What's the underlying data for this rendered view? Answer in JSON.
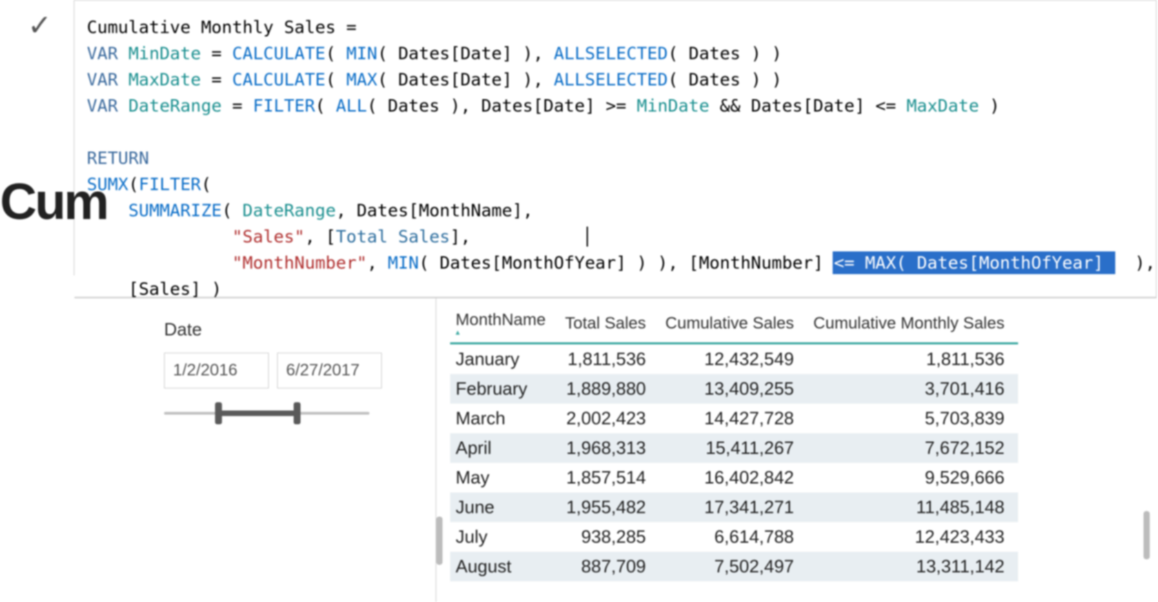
{
  "page_title_fragment": "Cum",
  "formula": {
    "lines": [
      [
        {
          "t": "Cumulative Monthly Sales = "
        }
      ],
      [
        {
          "t": "VAR ",
          "c": "var"
        },
        {
          "t": "MinDate",
          "c": "ref"
        },
        {
          "t": " = "
        },
        {
          "t": "CALCULATE",
          "c": "kw"
        },
        {
          "t": "( "
        },
        {
          "t": "MIN",
          "c": "kw"
        },
        {
          "t": "( Dates[Date] ), "
        },
        {
          "t": "ALLSELECTED",
          "c": "kw"
        },
        {
          "t": "( Dates ) )"
        }
      ],
      [
        {
          "t": "VAR ",
          "c": "var"
        },
        {
          "t": "MaxDate",
          "c": "ref"
        },
        {
          "t": " = "
        },
        {
          "t": "CALCULATE",
          "c": "kw"
        },
        {
          "t": "( "
        },
        {
          "t": "MAX",
          "c": "kw"
        },
        {
          "t": "( Dates[Date] ), "
        },
        {
          "t": "ALLSELECTED",
          "c": "kw"
        },
        {
          "t": "( Dates ) )"
        }
      ],
      [
        {
          "t": "VAR ",
          "c": "var"
        },
        {
          "t": "DateRange",
          "c": "ref"
        },
        {
          "t": " = "
        },
        {
          "t": "FILTER",
          "c": "kw"
        },
        {
          "t": "( "
        },
        {
          "t": "ALL",
          "c": "kw"
        },
        {
          "t": "( Dates ), Dates[Date] >= "
        },
        {
          "t": "MinDate",
          "c": "ref"
        },
        {
          "t": " && Dates[Date] <= "
        },
        {
          "t": "MaxDate",
          "c": "ref"
        },
        {
          "t": " )"
        }
      ],
      [
        {
          "t": " "
        }
      ],
      [
        {
          "t": "RETURN",
          "c": "retkw"
        }
      ],
      [
        {
          "t": "SUMX",
          "c": "kw"
        },
        {
          "t": "("
        },
        {
          "t": "FILTER",
          "c": "kw"
        },
        {
          "t": "("
        }
      ],
      [
        {
          "t": "    "
        },
        {
          "t": "SUMMARIZE",
          "c": "kw"
        },
        {
          "t": "( "
        },
        {
          "t": "DateRange",
          "c": "ref"
        },
        {
          "t": ", Dates[MonthName],"
        }
      ],
      [
        {
          "t": "              "
        },
        {
          "t": "\"Sales\"",
          "c": "str"
        },
        {
          "t": ", ["
        },
        {
          "t": "Total Sales",
          "c": "meas"
        },
        {
          "t": "],"
        },
        {
          "t": "           ",
          "cursor": true
        }
      ],
      [
        {
          "t": "              "
        },
        {
          "t": "\"MonthNumber\"",
          "c": "str"
        },
        {
          "t": ", "
        },
        {
          "t": "MIN",
          "c": "kw"
        },
        {
          "t": "( Dates[MonthOfYear] ) ), [MonthNumber] "
        },
        {
          "t": "<= MAX( Dates[MonthOfYear] ",
          "c": "sel"
        },
        {
          "t": "  ),"
        }
      ],
      [
        {
          "t": "    [Sales] )"
        }
      ]
    ]
  },
  "slicer": {
    "label": "Date",
    "start": "1/2/2016",
    "end": "6/27/2017"
  },
  "table": {
    "columns": [
      "MonthName",
      "Total Sales",
      "Cumulative Sales",
      "Cumulative Monthly Sales"
    ],
    "rows": [
      [
        "January",
        "1,811,536",
        "12,432,549",
        "1,811,536"
      ],
      [
        "February",
        "1,889,880",
        "13,409,255",
        "3,701,416"
      ],
      [
        "March",
        "2,002,423",
        "14,427,728",
        "5,703,839"
      ],
      [
        "April",
        "1,968,313",
        "15,411,267",
        "7,672,152"
      ],
      [
        "May",
        "1,857,514",
        "16,402,842",
        "9,529,666"
      ],
      [
        "June",
        "1,955,482",
        "17,341,271",
        "11,485,148"
      ],
      [
        "July",
        "938,285",
        "6,614,788",
        "12,423,433"
      ],
      [
        "August",
        "887,709",
        "7,502,497",
        "13,311,142"
      ]
    ]
  }
}
